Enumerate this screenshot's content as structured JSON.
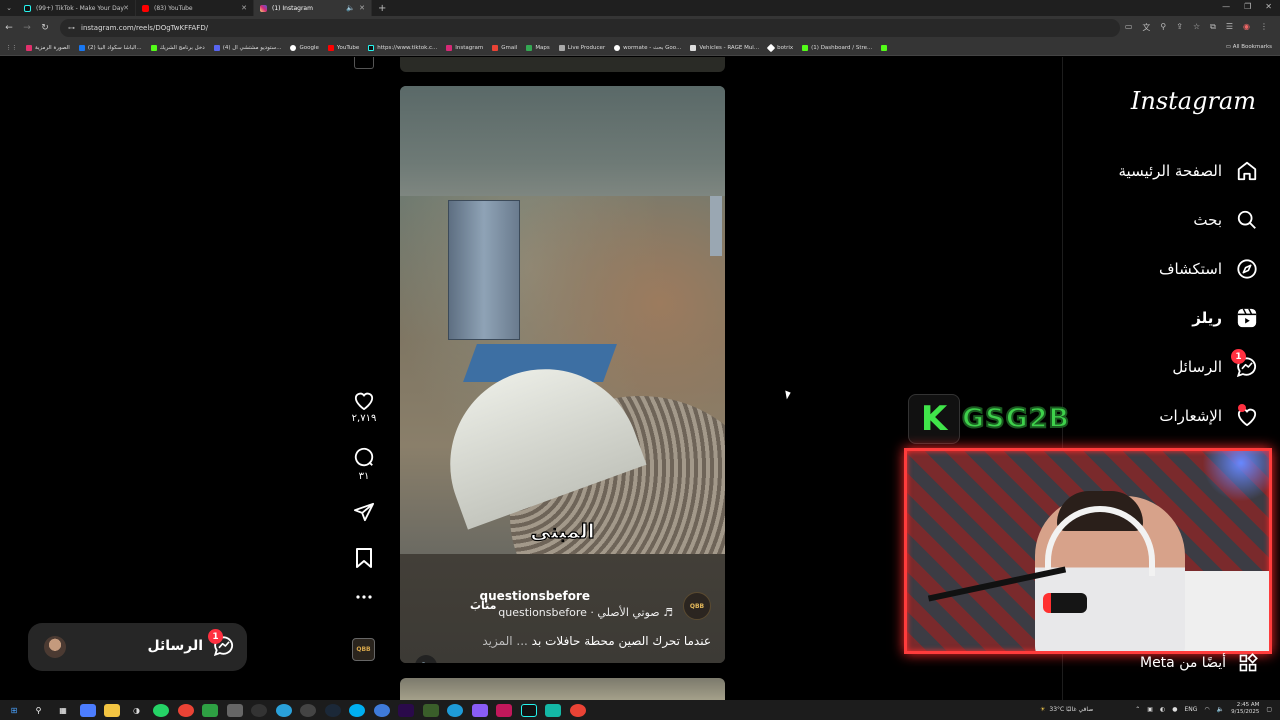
{
  "browser": {
    "tabs": [
      {
        "title": "(99+) TikTok - Make Your Day",
        "color": "#111111"
      },
      {
        "title": "(83) YouTube",
        "color": "#ff0000"
      },
      {
        "title": "(1) Instagram",
        "color": "#d62976"
      }
    ],
    "url": "instagram.com/reels/DOgTwKFFAFD/",
    "bookmarks": [
      {
        "label": "الصورة الرمزية",
        "color": "#e1306c"
      },
      {
        "label": "(2) الباشا سكواد البيا...",
        "color": "#1877f2"
      },
      {
        "label": "دخل برنامج الشريك",
        "color": "#53fc18"
      },
      {
        "label": "(4) ستوديو مشتشي ال...",
        "color": "#5865f2"
      },
      {
        "label": "Google",
        "color": "#ffffff"
      },
      {
        "label": "YouTube",
        "color": "#ff0000"
      },
      {
        "label": "https://www.tiktok.c...",
        "color": "#111111"
      },
      {
        "label": "Instagram",
        "color": "#d62976"
      },
      {
        "label": "Gmail",
        "color": "#ea4335"
      },
      {
        "label": "Maps",
        "color": "#34a853"
      },
      {
        "label": "Live Producer",
        "color": "#aaaaaa"
      },
      {
        "label": "wormate - بحث Goo...",
        "color": "#ffffff"
      },
      {
        "label": "Vehicles - RAGE Mul...",
        "color": "#dddddd"
      },
      {
        "label": "botrix",
        "color": "#ffffff"
      },
      {
        "label": "(1) Dashboard / Stre...",
        "color": "#53fc18"
      }
    ],
    "all_bookmarks": "All Bookmarks"
  },
  "reel": {
    "caption_word": "المبنى",
    "creator": "questionsbefore",
    "follow": "متابَ",
    "audio": "questionsbefore · صوتي الأصلي ♬",
    "description": "عندما تحرك الصين محطة حافلات بد",
    "more": "... المزيد",
    "avatar_text": "QBB",
    "likes": "٢,٧١٩",
    "comments": "٣١"
  },
  "nav": {
    "logo": "Instagram",
    "items": [
      {
        "label": "الصفحة الرئيسية",
        "icon": "home-icon"
      },
      {
        "label": "بحث",
        "icon": "search-icon"
      },
      {
        "label": "استكشاف",
        "icon": "explore-icon"
      },
      {
        "label": "ريلز",
        "icon": "reels-icon"
      },
      {
        "label": "الرسائل",
        "icon": "messenger-icon",
        "badge": "1"
      },
      {
        "label": "الإشعارات",
        "icon": "heart-icon"
      }
    ],
    "meta": "أيضًا من Meta"
  },
  "messages_pill": {
    "label": "الرسائل",
    "badge": "1"
  },
  "overlay": {
    "brand_letter": "K",
    "brand_text": "GSG2B",
    "accent": "#3ed04b",
    "frame_color": "#ff3c3c"
  },
  "taskbar": {
    "weather": "33°C  صافي غالبًا",
    "lang": "ENG",
    "time": "2:45 AM",
    "date": "9/15/2025"
  }
}
